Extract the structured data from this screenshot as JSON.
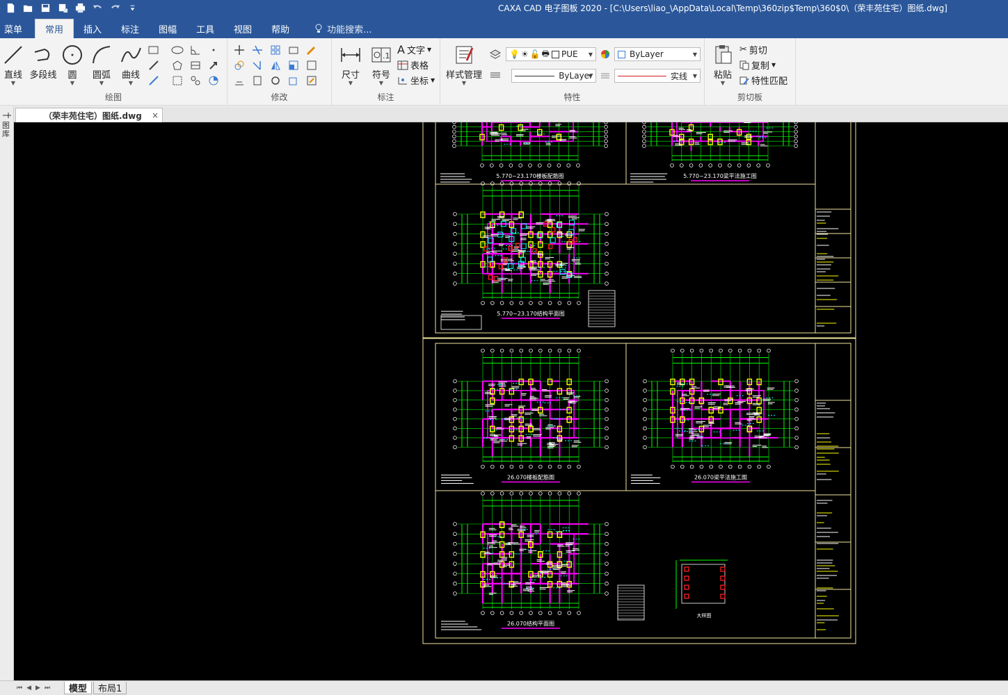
{
  "window": {
    "title": "CAXA CAD 电子图板 2020 - [C:\\Users\\liao_\\AppData\\Local\\Temp\\360zip$Temp\\360$0\\（荣丰苑住宅）图纸.dwg]"
  },
  "quick_access": [
    {
      "name": "new-file-icon"
    },
    {
      "name": "open-folder-icon"
    },
    {
      "name": "save-icon"
    },
    {
      "name": "save-as-icon"
    },
    {
      "name": "print-icon"
    },
    {
      "name": "undo-icon"
    },
    {
      "name": "redo-icon"
    },
    {
      "name": "customize-icon"
    }
  ],
  "tabs": {
    "menu": "菜单",
    "common": "常用",
    "insert": "插入",
    "annotate": "标注",
    "sheet": "图幅",
    "tools": "工具",
    "view": "视图",
    "help": "帮助",
    "search": "功能搜索..."
  },
  "ribbon": {
    "draw": {
      "label": "绘图",
      "line": "直线",
      "polyline": "多段线",
      "circle": "圆",
      "arc": "圆弧",
      "curve": "曲线"
    },
    "modify": {
      "label": "修改"
    },
    "annotate": {
      "label": "标注",
      "dimension": "尺寸",
      "symbol": "符号",
      "text": "文字",
      "table": "表格",
      "coordinate": "坐标"
    },
    "properties": {
      "label": "特性",
      "style_manager": "样式管理",
      "layer_value": "PUE",
      "color_value": "ByLayer",
      "linetype_value": "ByLayer",
      "linestyle_value": "实线"
    },
    "clipboard": {
      "label": "剪切板",
      "paste": "粘贴",
      "cut": "剪切",
      "copy": "复制",
      "match_properties": "特性匹配"
    }
  },
  "document_tab": {
    "name": "（荣丰苑住宅）图纸.dwg",
    "close": "×"
  },
  "left_strip": {
    "label": "图库"
  },
  "drawing": {
    "title_labels": [
      "5.770~23.170楼板配筋图",
      "5.770~23.170梁平法施工图",
      "5.770~23.170结构平面图",
      "26.070楼板配筋图",
      "26.070梁平法施工图",
      "26.070结构平面图",
      "大样图"
    ],
    "colors": {
      "background": "#000000",
      "frame": "#f2e6a0",
      "grid": "#00ff00",
      "wall_magenta": "#ff00ff",
      "column_yellow": "#ffff00",
      "cyan": "#00ffff",
      "red": "#ff2020",
      "white": "#ffffff"
    }
  },
  "layout_tabs": {
    "model": "模型",
    "layout1": "布局1"
  },
  "nav_arrows": [
    "⏮",
    "◀",
    "▶",
    "⏭"
  ]
}
